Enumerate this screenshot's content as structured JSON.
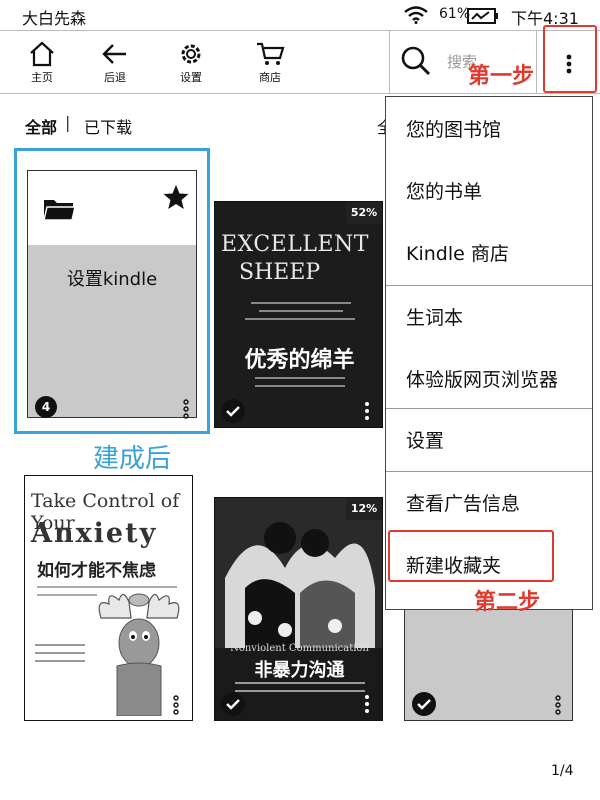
{
  "status_bar": {
    "device_name": "大白先森",
    "battery": "61%",
    "time": "下午4:31"
  },
  "toolbar": {
    "home_label": "主页",
    "back_label": "后退",
    "settings_label": "设置",
    "store_label": "商店",
    "search_placeholder": "搜索"
  },
  "annotations": {
    "step1": "第一步",
    "step2": "第二步",
    "after_created": "建成后"
  },
  "filter": {
    "all": "全部",
    "separator": "|",
    "downloaded": "已下载",
    "sort_partial": "全"
  },
  "library": {
    "collection": {
      "title": "设置kindle",
      "count": "4"
    },
    "books": [
      {
        "id": "sheep",
        "title_en_1": "EXCELLENT",
        "title_en_2": "SHEEP",
        "title_cn": "优秀的绵羊",
        "progress": "52%"
      },
      {
        "id": "anxiety",
        "title_en_1": "Take Control of Your",
        "title_en_2": "Anxiety",
        "title_cn": "如何才能不焦虑"
      },
      {
        "id": "nvc",
        "title_en": "Nonviolent Communication",
        "title_cn": "非暴力沟通",
        "progress": "12%"
      },
      {
        "id": "grey"
      }
    ]
  },
  "menu": {
    "items": [
      "您的图书馆",
      "您的书单",
      "Kindle 商店",
      "生词本",
      "体验版网页浏览器",
      "设置",
      "查看广告信息",
      "新建收藏夹"
    ]
  },
  "pagination": "1/4",
  "colors": {
    "annotation_red": "#e03a2e",
    "highlight_blue": "#3aa2d6"
  }
}
